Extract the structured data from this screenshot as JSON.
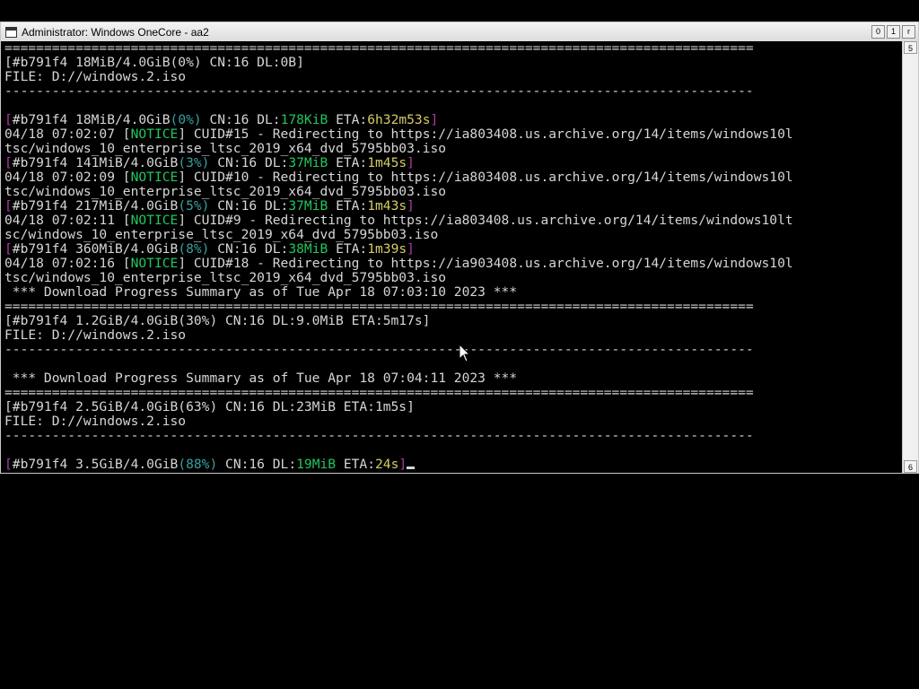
{
  "window": {
    "title": "Administrator:  Windows OneCore - aa2",
    "buttons": {
      "minimize": "0",
      "maximize": "1",
      "close": "r"
    },
    "scroll_up": "5",
    "scroll_down": "6"
  },
  "colors": {
    "green": "#22c55e",
    "cyan": "#3aa0a0",
    "yellow": "#d6cc66",
    "magenta": "#b03aa0",
    "text": "#d6d6d6"
  },
  "console": {
    "l1": "===============================================================================================",
    "l2": "[#b791f4 18MiB/4.0GiB(0%) CN:16 DL:0B]",
    "l3": "FILE: D://windows.2.iso",
    "l4": "-----------------------------------------------------------------------------------------------",
    "l5": "",
    "p1": {
      "ob": "[",
      "a": "#b791f4 18MiB/4.0GiB",
      "pct": "(0%)",
      "b": " CN:16 DL:",
      "dl": "178KiB",
      "c": " ETA:",
      "eta": "6h32m53s",
      "cb": "]"
    },
    "n1": {
      "ts": "04/18 07:02:07 ",
      "lb": "[",
      "tag": "NOTICE",
      "rb": "]",
      "msg": " CUID#15 - Redirecting to https://ia803408.us.archive.org/14/items/windows10l"
    },
    "n1b": "tsc/windows_10_enterprise_ltsc_2019_x64_dvd_5795bb03.iso",
    "p2": {
      "ob": "[",
      "a": "#b791f4 141MiB/4.0GiB",
      "pct": "(3%)",
      "b": " CN:16 DL:",
      "dl": "37MiB",
      "c": " ETA:",
      "eta": "1m45s",
      "cb": "]"
    },
    "n2": {
      "ts": "04/18 07:02:09 ",
      "lb": "[",
      "tag": "NOTICE",
      "rb": "]",
      "msg": " CUID#10 - Redirecting to https://ia803408.us.archive.org/14/items/windows10l"
    },
    "n2b": "tsc/windows_10_enterprise_ltsc_2019_x64_dvd_5795bb03.iso",
    "p3": {
      "ob": "[",
      "a": "#b791f4 217MiB/4.0GiB",
      "pct": "(5%)",
      "b": " CN:16 DL:",
      "dl": "37MiB",
      "c": " ETA:",
      "eta": "1m43s",
      "cb": "]"
    },
    "n3": {
      "ts": "04/18 07:02:11 ",
      "lb": "[",
      "tag": "NOTICE",
      "rb": "]",
      "msg": " CUID#9 - Redirecting to https://ia803408.us.archive.org/14/items/windows10lt"
    },
    "n3b": "sc/windows_10_enterprise_ltsc_2019_x64_dvd_5795bb03.iso",
    "p4": {
      "ob": "[",
      "a": "#b791f4 360MiB/4.0GiB",
      "pct": "(8%)",
      "b": " CN:16 DL:",
      "dl": "38MiB",
      "c": " ETA:",
      "eta": "1m39s",
      "cb": "]"
    },
    "n4": {
      "ts": "04/18 07:02:16 ",
      "lb": "[",
      "tag": "NOTICE",
      "rb": "]",
      "msg": " CUID#18 - Redirecting to https://ia903408.us.archive.org/14/items/windows10l"
    },
    "n4b": "tsc/windows_10_enterprise_ltsc_2019_x64_dvd_5795bb03.iso",
    "s1": " *** Download Progress Summary as of Tue Apr 18 07:03:10 2023 ***",
    "s1a": "===============================================================================================",
    "s1b": "[#b791f4 1.2GiB/4.0GiB(30%) CN:16 DL:9.0MiB ETA:5m17s]",
    "s1c": "FILE: D://windows.2.iso",
    "s1d": "-----------------------------------------------------------------------------------------------",
    "s1e": "",
    "s2": " *** Download Progress Summary as of Tue Apr 18 07:04:11 2023 ***",
    "s2a": "===============================================================================================",
    "s2b": "[#b791f4 2.5GiB/4.0GiB(63%) CN:16 DL:23MiB ETA:1m5s]",
    "s2c": "FILE: D://windows.2.iso",
    "s2d": "-----------------------------------------------------------------------------------------------",
    "s2e": "",
    "p5": {
      "ob": "[",
      "a": "#b791f4 3.5GiB/4.0GiB",
      "pct": "(88%)",
      "b": " CN:16 DL:",
      "dl": "19MiB",
      "c": " ETA:",
      "eta": "24s",
      "cb": "]"
    }
  }
}
